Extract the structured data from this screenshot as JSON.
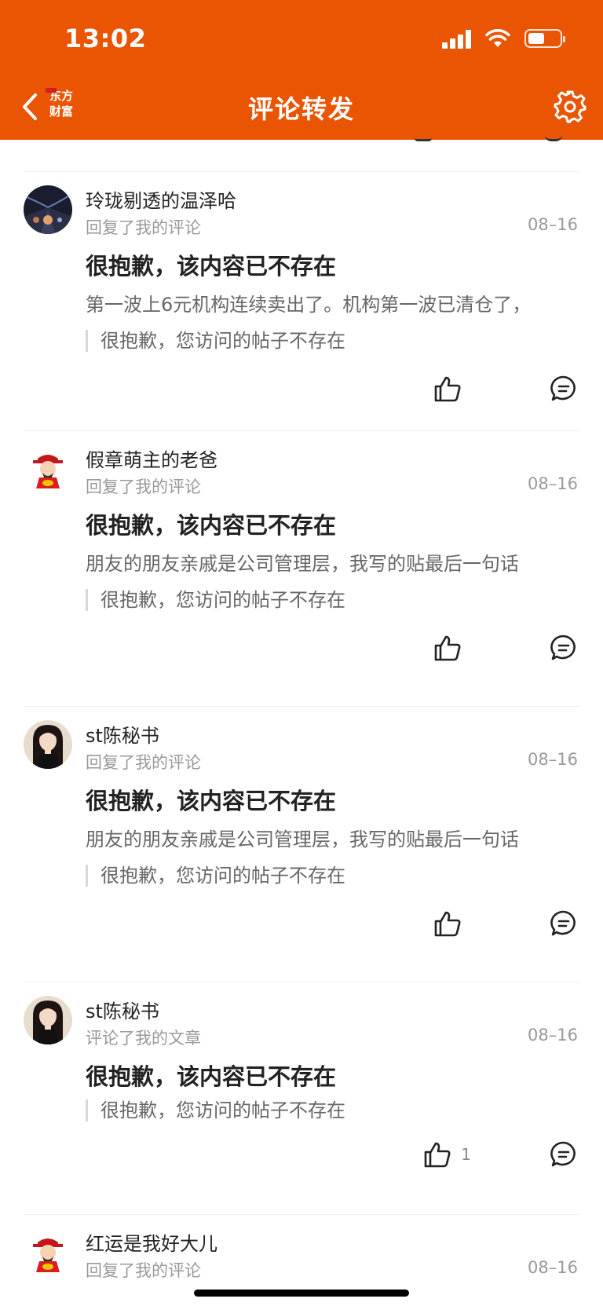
{
  "status_bar": {
    "time": "13:02",
    "battery_level": 0.45
  },
  "nav": {
    "title": "评论转发",
    "logo_line1": "东方",
    "logo_line2": "财富",
    "accent": "#EA5504"
  },
  "items": [
    {
      "username": "玲珑剔透的温泽哈",
      "action": "回复了我的评论",
      "date": "08–16",
      "title": "很抱歉，该内容已不存在",
      "reply": "第一波上6元机构连续卖出了。机构第一波已清仓了，",
      "quote": "很抱歉，您访问的帖子不存在",
      "likes": "",
      "avatar": "night-road-avatar"
    },
    {
      "username": "假章萌主的老爸",
      "action": "回复了我的评论",
      "date": "08–16",
      "title": "很抱歉，该内容已不存在",
      "reply": "朋友的朋友亲戚是公司管理层，我写的贴最后一句话",
      "quote": "很抱歉，您访问的帖子不存在",
      "likes": "",
      "avatar": "caishen-avatar"
    },
    {
      "username": "st陈秘书",
      "action": "回复了我的评论",
      "date": "08–16",
      "title": "很抱歉，该内容已不存在",
      "reply": "朋友的朋友亲戚是公司管理层，我写的贴最后一句话",
      "quote": "很抱歉，您访问的帖子不存在",
      "likes": "",
      "avatar": "girl-avatar"
    },
    {
      "username": "st陈秘书",
      "action": "评论了我的文章",
      "date": "08–16",
      "title": "很抱歉，该内容已不存在",
      "reply": "",
      "quote": "很抱歉，您访问的帖子不存在",
      "likes": "1",
      "avatar": "girl-avatar"
    },
    {
      "username": "红运是我好大儿",
      "action": "回复了我的评论",
      "date": "08–16",
      "title": "",
      "reply": "",
      "quote": "",
      "likes": "",
      "avatar": "caishen-avatar"
    }
  ]
}
